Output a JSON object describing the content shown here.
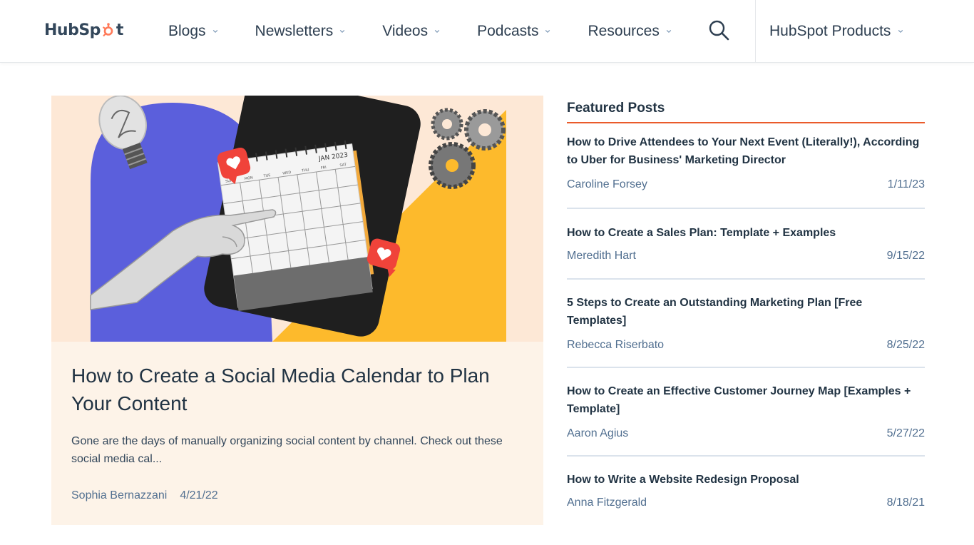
{
  "header": {
    "logo_text_left": "HubSp",
    "logo_text_right": "t",
    "nav": [
      {
        "label": "Blogs"
      },
      {
        "label": "Newsletters"
      },
      {
        "label": "Videos"
      },
      {
        "label": "Podcasts"
      },
      {
        "label": "Resources"
      }
    ],
    "products_label": "HubSpot Products",
    "brand_color": "#ff7a59"
  },
  "hero": {
    "title": "How to Create a Social Media Calendar to Plan Your Content",
    "excerpt": "Gone are the days of manually organizing social content by channel. Check out these social media cal...",
    "author": "Sophia Bernazzani",
    "date": "4/21/22",
    "calendar_label": "JAN 2023",
    "weekdays": [
      "SUN",
      "MON",
      "TUE",
      "WED",
      "THU",
      "FRI",
      "SAT"
    ]
  },
  "featured": {
    "heading": "Featured Posts",
    "accent_color": "#ea5b2b",
    "posts": [
      {
        "title": "How to Drive Attendees to Your Next Event (Literally!), According to Uber for Business' Marketing Director",
        "author": "Caroline Forsey",
        "date": "1/11/23"
      },
      {
        "title": "How to Create a Sales Plan: Template + Examples",
        "author": "Meredith Hart",
        "date": "9/15/22"
      },
      {
        "title": "5 Steps to Create an Outstanding Marketing Plan [Free Templates]",
        "author": "Rebecca Riserbato",
        "date": "8/25/22"
      },
      {
        "title": "How to Create an Effective Customer Journey Map [Examples + Template]",
        "author": "Aaron Agius",
        "date": "5/27/22"
      },
      {
        "title": "How to Write a Website Redesign Proposal",
        "author": "Anna Fitzgerald",
        "date": "8/18/21"
      }
    ]
  }
}
